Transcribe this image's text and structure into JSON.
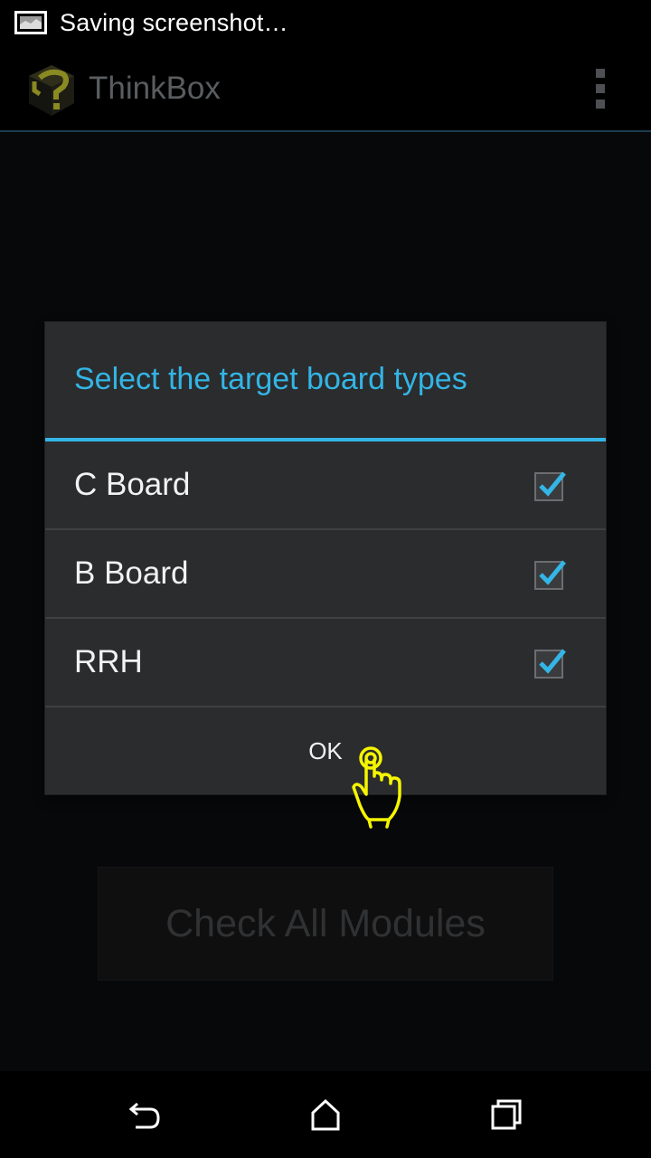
{
  "status_bar": {
    "notification_icon": "screenshot-icon",
    "text": "Saving screenshot…"
  },
  "action_bar": {
    "app_icon": "thinkbox-logo",
    "title": "ThinkBox",
    "overflow_icon": "overflow-menu-icon"
  },
  "dialog": {
    "title": "Select the target board types",
    "options": [
      {
        "label": "C Board",
        "checked": true
      },
      {
        "label": "B Board",
        "checked": true
      },
      {
        "label": "RRH",
        "checked": true
      }
    ],
    "ok_label": "OK"
  },
  "main": {
    "check_all_label": "Check All Modules"
  },
  "nav_bar": {
    "back_icon": "back-icon",
    "home_icon": "home-icon",
    "recents_icon": "recents-icon"
  },
  "colors": {
    "accent": "#33b5e5",
    "dialog_bg": "#2b2c2e",
    "touch_indicator": "#f5f500"
  }
}
